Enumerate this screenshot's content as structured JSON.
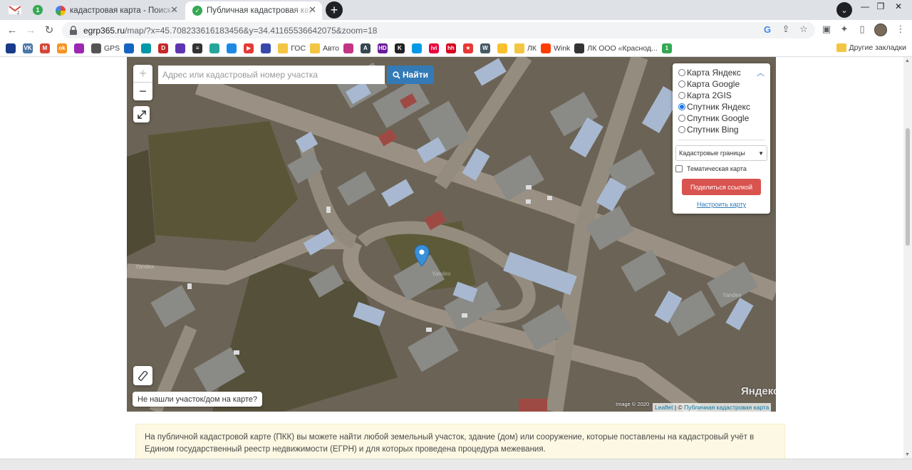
{
  "browser": {
    "pinned_tabs": [
      {
        "icon": "gmail-icon",
        "label": "M2"
      },
      {
        "icon": "badge-icon",
        "label": "1"
      }
    ],
    "tabs": [
      {
        "title": "кадастровая карта - Поиск в Go",
        "favicon": "google-icon",
        "active": false
      },
      {
        "title": "Публичная кадастровая карта -",
        "favicon": "check-circle-icon",
        "active": true
      }
    ],
    "url_host": "egrp365.ru",
    "url_path": "/map/?x=45.708233616183456&y=34.41165536642075&zoom=18",
    "bookmarks": [
      {
        "label": "",
        "icon": "vw-icon",
        "color": "#1a3b8a"
      },
      {
        "label": "",
        "icon": "vk-icon",
        "color": "#4a76a8",
        "text": "VK"
      },
      {
        "label": "",
        "icon": "gmail-icon",
        "color": "#d44638",
        "text": "M"
      },
      {
        "label": "",
        "icon": "ok-icon",
        "color": "#f7931e",
        "text": "ok"
      },
      {
        "label": "",
        "icon": "app-icon",
        "color": "#9c27b0",
        "text": ""
      },
      {
        "label": "GPS",
        "icon": "globe-icon",
        "color": "#555",
        "text": ""
      },
      {
        "label": "",
        "icon": "mail-icon",
        "color": "#1565c0",
        "text": ""
      },
      {
        "label": "",
        "icon": "pen-icon",
        "color": "#0097a7",
        "text": ""
      },
      {
        "label": "",
        "icon": "d-icon",
        "color": "#c62828",
        "text": "D"
      },
      {
        "label": "",
        "icon": "docs-icon",
        "color": "#5e35b1",
        "text": ""
      },
      {
        "label": "",
        "icon": "menu-icon",
        "color": "#333",
        "text": "≡"
      },
      {
        "label": "",
        "icon": "tv-icon",
        "color": "#26a69a",
        "text": ""
      },
      {
        "label": "",
        "icon": "chart-icon",
        "color": "#1e88e5",
        "text": ""
      },
      {
        "label": "",
        "icon": "youtube-icon",
        "color": "#e53935",
        "text": "▶"
      },
      {
        "label": "",
        "icon": "flag-icon",
        "color": "#3949ab",
        "text": ""
      },
      {
        "label": "ГОС",
        "icon": "folder-icon",
        "folder": true
      },
      {
        "label": "Авто",
        "icon": "folder-icon",
        "folder": true
      },
      {
        "label": "",
        "icon": "instagram-icon",
        "color": "#c13584",
        "text": ""
      },
      {
        "label": "",
        "icon": "triangle-icon",
        "color": "#37474f",
        "text": "A"
      },
      {
        "label": "",
        "icon": "hd-icon",
        "color": "#6a1b9a",
        "text": "HD"
      },
      {
        "label": "",
        "icon": "kinopoisk-icon",
        "color": "#222",
        "text": "K"
      },
      {
        "label": "",
        "icon": "settings-icon",
        "color": "#039be5",
        "text": ""
      },
      {
        "label": "",
        "icon": "ivi-icon",
        "color": "#ea003d",
        "text": "ivi"
      },
      {
        "label": "",
        "icon": "hh-icon",
        "color": "#d6001c",
        "text": "hh"
      },
      {
        "label": "",
        "icon": "star-icon",
        "color": "#e53935",
        "text": "★"
      },
      {
        "label": "",
        "icon": "w-icon",
        "color": "#455a64",
        "text": "W"
      },
      {
        "label": "",
        "icon": "bookmark-icon",
        "color": "#fbc02d",
        "text": ""
      },
      {
        "label": "ЛК",
        "icon": "folder-icon",
        "folder": true
      },
      {
        "label": "Wink",
        "icon": "wink-icon",
        "color": "#ff3d00",
        "text": ""
      },
      {
        "label": "ЛК ООО «Краснод...",
        "icon": "github-icon",
        "color": "#333",
        "text": ""
      },
      {
        "label": "",
        "icon": "badge-icon",
        "color": "#34a853",
        "text": "1"
      }
    ],
    "other_bookmarks": "Другие закладки"
  },
  "map": {
    "zoom_in": "+",
    "zoom_out": "−",
    "search_placeholder": "Адрес или кадастровый номер участка",
    "search_button": "Найти",
    "layers": {
      "options": [
        {
          "label": "Карта Яндекс",
          "selected": false
        },
        {
          "label": "Карта Google",
          "selected": false
        },
        {
          "label": "Карта 2GIS",
          "selected": false
        },
        {
          "label": "Спутник Яндекс",
          "selected": true
        },
        {
          "label": "Спутник Google",
          "selected": false
        },
        {
          "label": "Спутник Bing",
          "selected": false
        }
      ],
      "overlay_select": "Кадастровые границы",
      "thematic_label": "Тематическая карта",
      "thematic_checked": false,
      "share_button": "Поделиться ссылкой",
      "configure_link": "Настроить карту"
    },
    "not_found": "Не нашли участок/дом на карте?",
    "yandex_logo": "Яндекс",
    "image_copyright": "Image © 2020",
    "attribution_leaflet": "Leaflet",
    "attribution_sep": " | © ",
    "attribution_pkk": "Публичная кадастровая карта",
    "watermark": "Yandex"
  },
  "info_text": "На публичной кадастровой карте (ПКК) вы можете найти любой земельный участок, здание (дом) или сооружение, которые поставлены на кадастровый учёт в Едином государственный реестр недвижимости (ЕГРН) и для которых проведена процедура межевания.",
  "colors": {
    "primary": "#337ab7",
    "danger": "#d9534f",
    "info_bg": "#fcf8e3",
    "marker": "#3a8fd9"
  }
}
